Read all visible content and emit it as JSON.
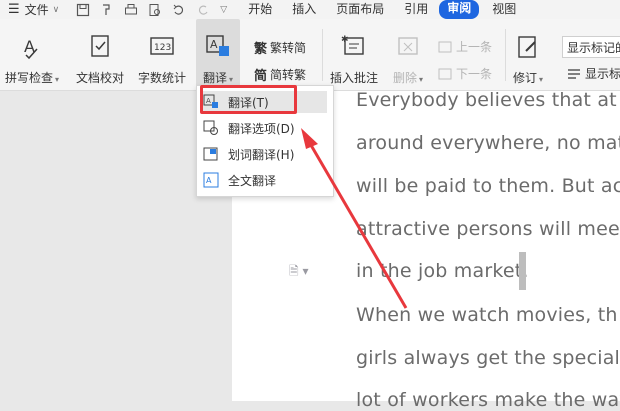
{
  "menubar": {
    "file_label": "文件",
    "tabs": [
      {
        "label": "开始"
      },
      {
        "label": "插入"
      },
      {
        "label": "页面布局"
      },
      {
        "label": "引用"
      },
      {
        "label": "审阅",
        "active": true
      },
      {
        "label": "视图"
      }
    ]
  },
  "ribbon": {
    "spell_check": "拼写检查",
    "doc_proof": "文档校对",
    "word_count": "字数统计",
    "translate": "翻译",
    "trad_simp": "繁转简",
    "simp_trad": "简转繁",
    "insert_comment": "插入批注",
    "delete": "删除",
    "previous": "上一条",
    "next": "下一条",
    "revise": "修订",
    "show_markup_final": "显示标记的",
    "show_markup": "显示标"
  },
  "dropdown": {
    "items": [
      {
        "label": "翻译(T)",
        "icon": "translate-icon"
      },
      {
        "label": "翻译选项(D)",
        "icon": "translate-options-icon"
      },
      {
        "label": "划词翻译(H)",
        "icon": "word-translate-icon"
      },
      {
        "label": "全文翻译",
        "icon": "full-text-translate-icon"
      }
    ]
  },
  "document": {
    "lines": [
      "Everybody believes that at",
      "around everywhere, no matt",
      "will be paid to them. But ac",
      "attractive persons will meet",
      "in the job market.",
      "When we watch movies, th",
      "girls always get the special t",
      "lot of workers make the way"
    ]
  },
  "colors": {
    "accent": "#1e66e0",
    "highlight": "#e8383d"
  }
}
